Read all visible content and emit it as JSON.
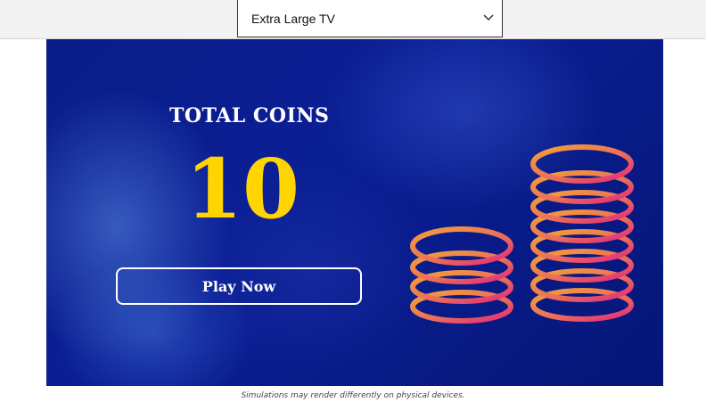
{
  "device_select": {
    "selected": "Extra Large TV",
    "icon": "chevron-down-icon"
  },
  "stage": {
    "title": "TOTAL COINS",
    "coin_count": "10",
    "play_button_label": "Play Now",
    "illustration": "coin-stacks-icon",
    "colors": {
      "background": "#0b1f95",
      "count": "#ffd400",
      "coin_gradient_start": "#f2a23a",
      "coin_gradient_end": "#e0287f"
    }
  },
  "footer": {
    "caption": "Simulations may render differently on physical devices."
  }
}
